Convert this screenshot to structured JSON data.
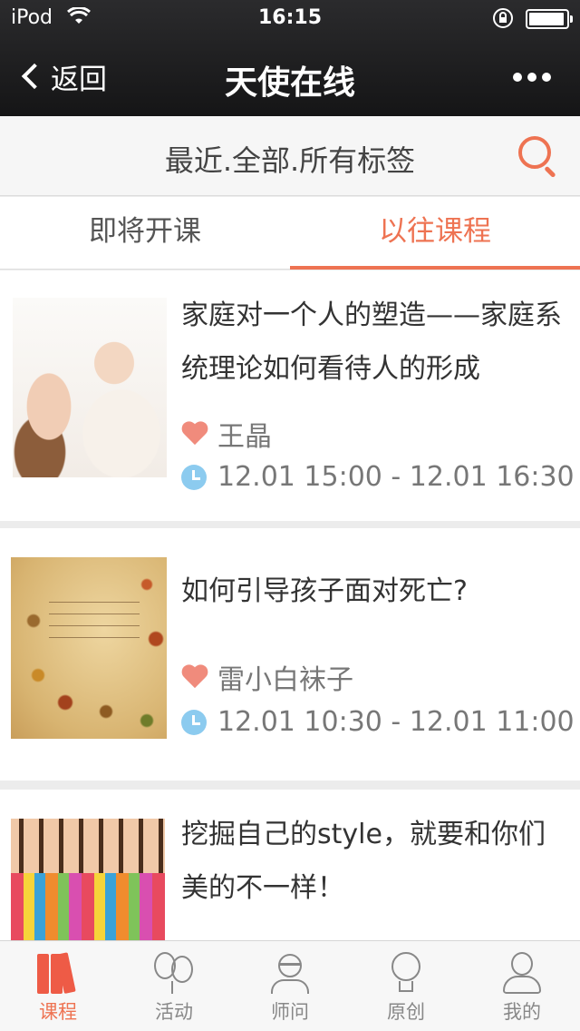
{
  "status_bar": {
    "carrier": "iPod",
    "time": "16:15"
  },
  "nav": {
    "back_label": "返回",
    "title": "天使在线"
  },
  "filter": {
    "label": "最近.全部.所有标签"
  },
  "tabs": [
    {
      "label": "即将开课",
      "active": false
    },
    {
      "label": "以往课程",
      "active": true
    }
  ],
  "courses": [
    {
      "title": "家庭对一个人的塑造——家庭系统理论如何看待人的形成",
      "teacher": "王晶",
      "time": "12.01 15:00 - 12.01 16:30"
    },
    {
      "title": "如何引导孩子面对死亡?",
      "teacher": "雷小白袜子",
      "time": "12.01 10:30 - 12.01 11:00"
    },
    {
      "title": "挖掘自己的style，就要和你们美的不一样！",
      "teacher": "",
      "time": ""
    }
  ],
  "tabbar": [
    {
      "label": "课程",
      "icon": "books-icon",
      "active": true
    },
    {
      "label": "活动",
      "icon": "balloons-icon",
      "active": false
    },
    {
      "label": "师问",
      "icon": "teacher-icon",
      "active": false
    },
    {
      "label": "原创",
      "icon": "lightbulb-icon",
      "active": false
    },
    {
      "label": "我的",
      "icon": "person-icon",
      "active": false
    }
  ],
  "colors": {
    "accent": "#ee7352",
    "header": "#1f1f20",
    "heart": "#f08b7c",
    "clock": "#8ccbef"
  }
}
